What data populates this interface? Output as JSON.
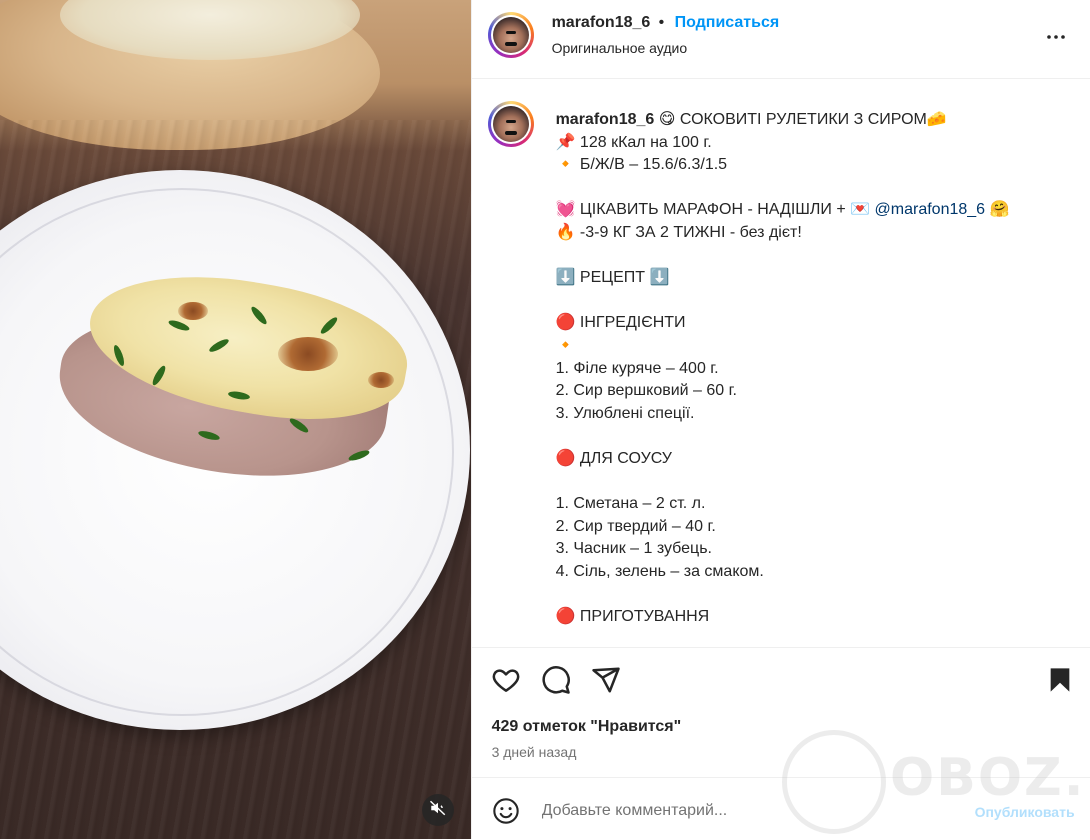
{
  "header": {
    "username": "marafon18_6",
    "separator": "•",
    "follow_label": "Подписаться",
    "audio_label": "Оригинальное аудио"
  },
  "caption": {
    "lines": [
      "",
      "📌 128 кКал на 100 г.",
      "🔸 Б/Ж/В – 15.6/6.3/1.5",
      "",
      "💓 ЦІКАВИТЬ МАРАФОН - НАДІШЛИ + 💌",
      "🔥 -3-9 КГ ЗА 2 ТИЖНІ - без дієт!",
      "",
      "⬇️ РЕЦЕПТ ⬇️",
      "",
      "🔴 ІНГРЕДІЄНТИ",
      "🔸",
      "1. Філе куряче – 400 г.",
      "2. Сир вершковий – 60 г.",
      "3. Улюблені спеції.",
      "",
      "🔴 ДЛЯ СОУСУ",
      "",
      "1. Сметана – 2 ст. л.",
      "2. Сир твердий – 40 г.",
      "3. Часник – 1 зубець.",
      "4. Сіль, зелень – за смаком.",
      "",
      "🔴 ПРИГОТУВАННЯ"
    ],
    "title_text": "😋 СОКОВИТІ РУЛЕТИКИ З СИРОМ🧀",
    "mention": "@marafon18_6",
    "mention_suffix": " 🤗"
  },
  "actions": {
    "icons": [
      "heart-icon",
      "comment-icon",
      "share-icon",
      "bookmark-icon"
    ],
    "likes_text": "429 отметок \"Нравится\"",
    "time_ago": "3 дней назад"
  },
  "comment": {
    "placeholder": "Добавьте комментарий...",
    "publish_label": "Опубликовать"
  },
  "media": {
    "mute_icon": "speaker-muted-icon"
  },
  "watermark": {
    "text": "OBOZ.UA"
  },
  "colors": {
    "accent_blue": "#0095f6",
    "publish_disabled": "#b2dffc",
    "text_primary": "#262626",
    "text_secondary": "#737373",
    "mention": "#00376b"
  }
}
